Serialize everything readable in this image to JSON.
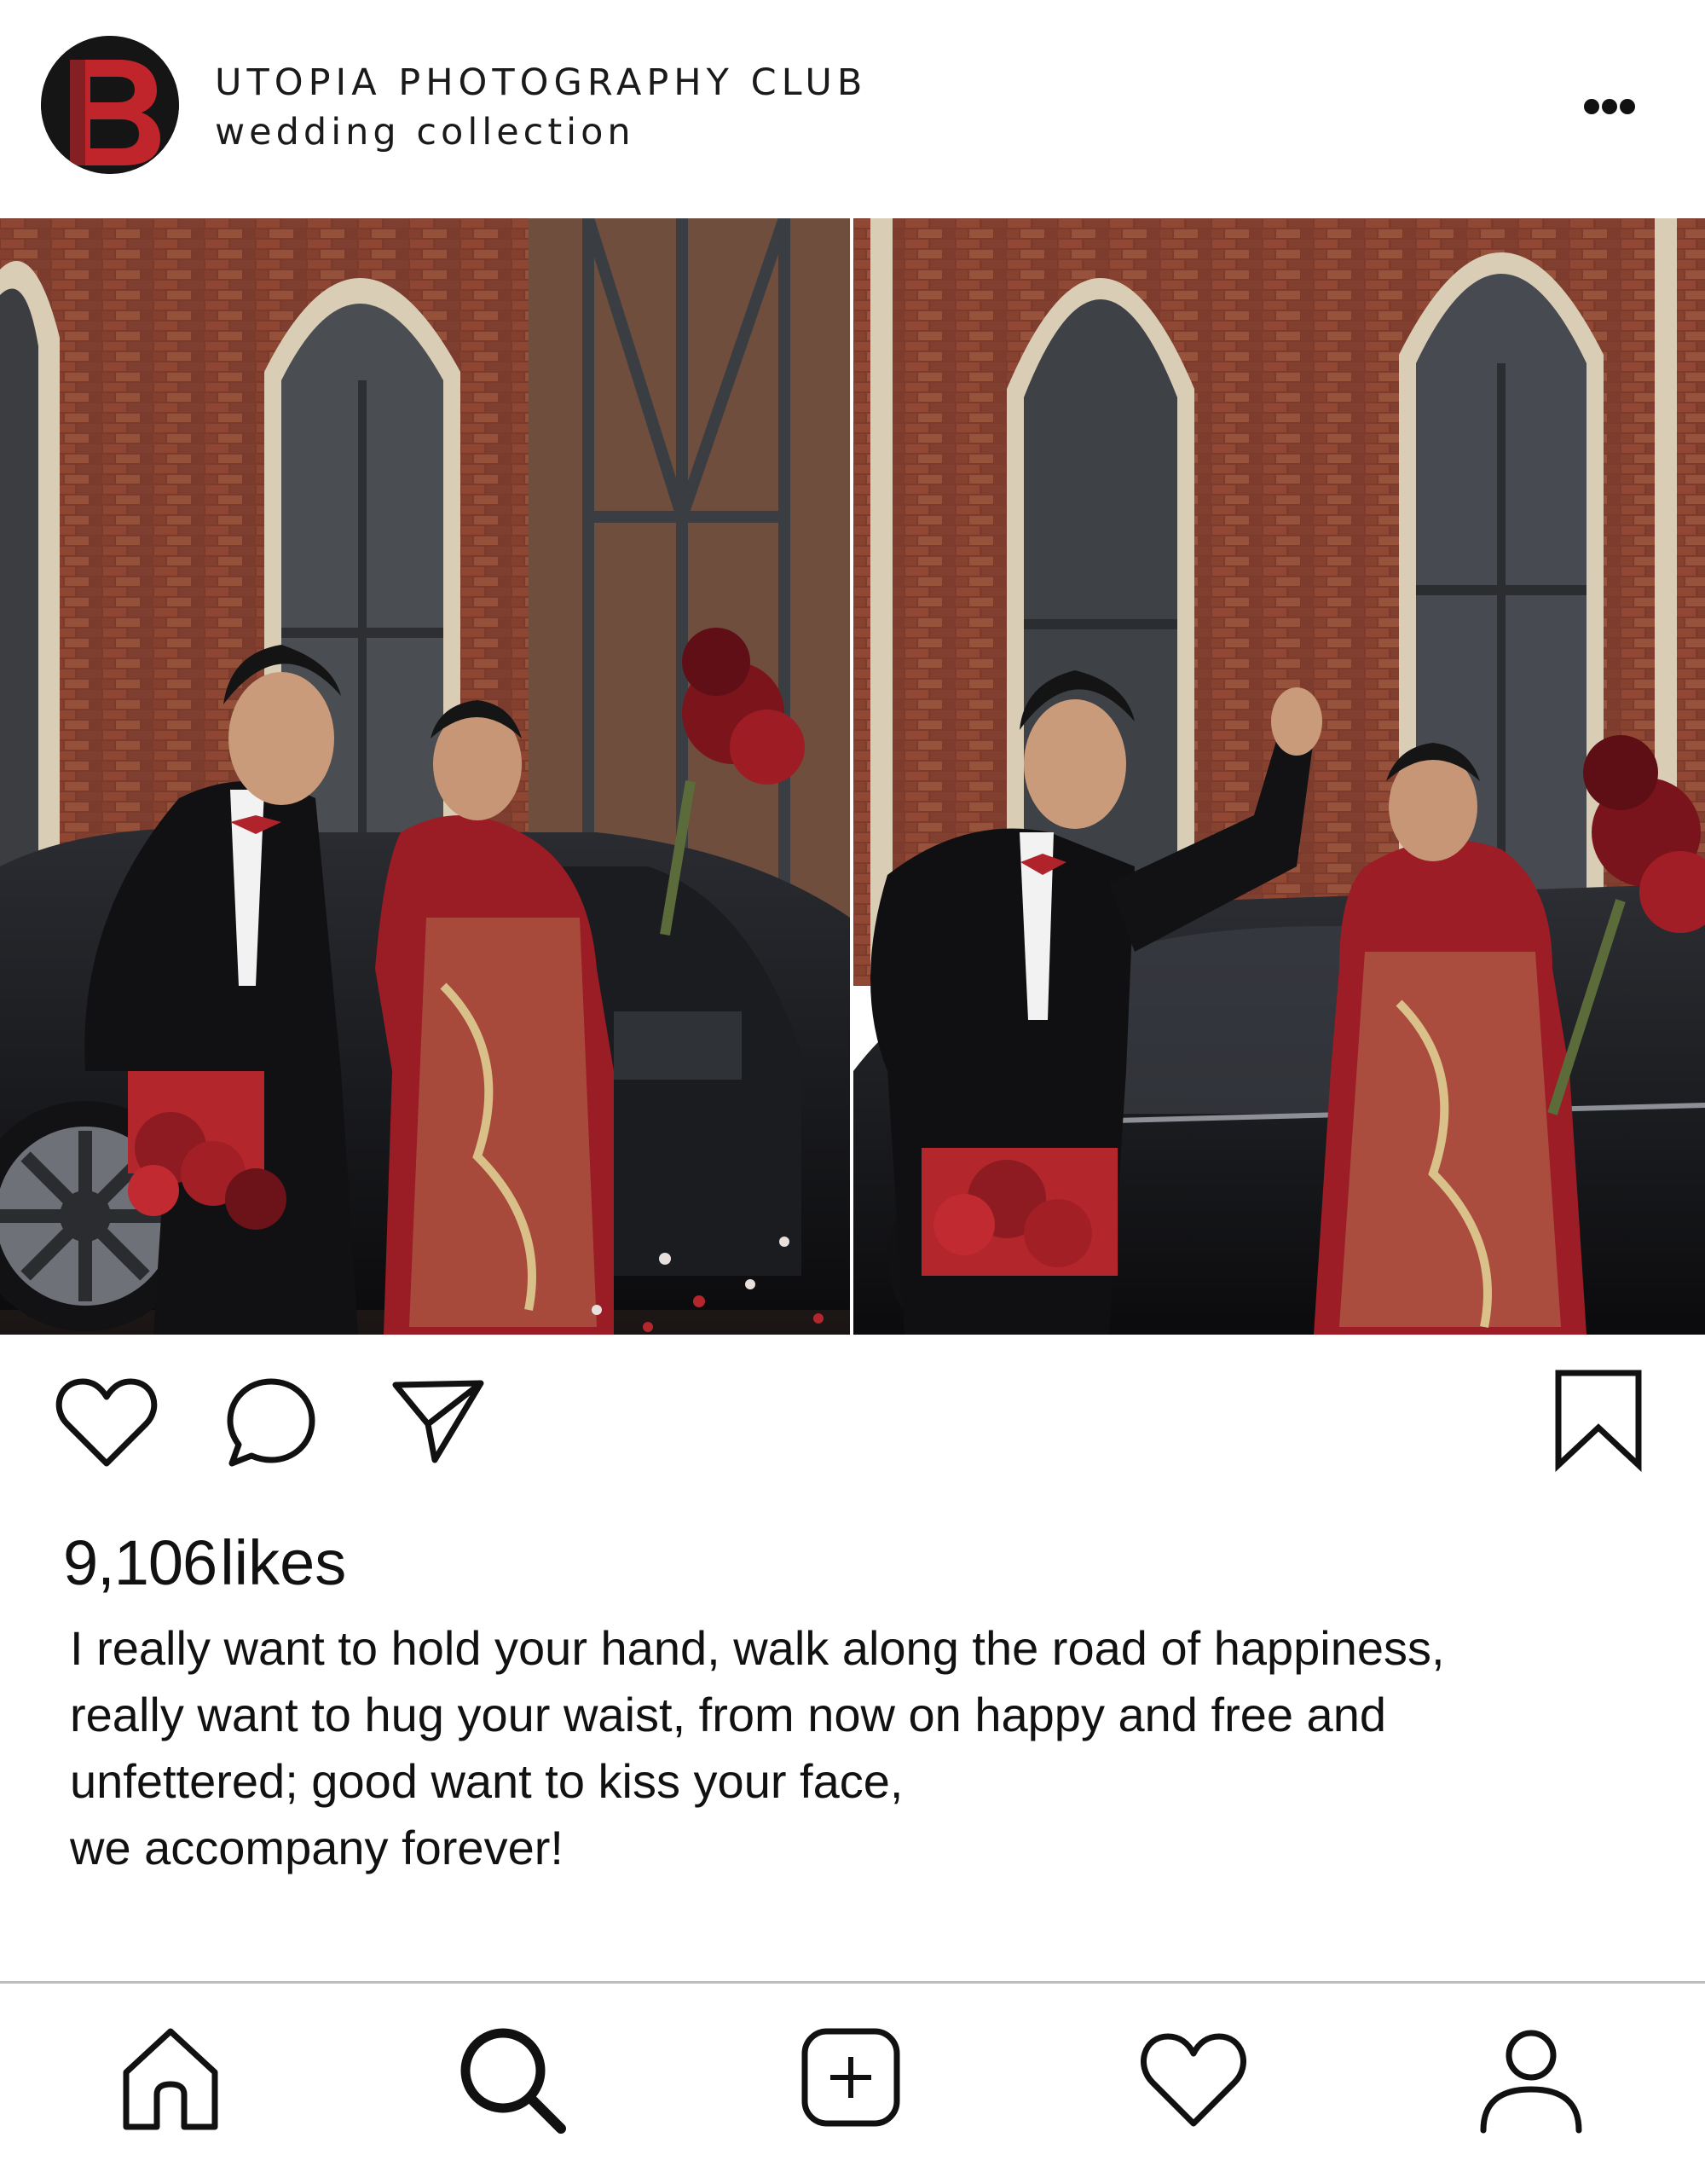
{
  "header": {
    "account_name": "UTOPIA PHOTOGRAPHY CLUB",
    "account_subtitle": "wedding collection",
    "avatar_letter": "B",
    "avatar_icon": "b-logo-avatar",
    "more_icon": "more-horizontal-icon"
  },
  "post": {
    "photos": [
      {
        "name": "wedding-photo-left",
        "scene": "groom in black tuxedo and bride in red embroidered dress beside black car, brick arched windows"
      },
      {
        "name": "wedding-photo-right",
        "scene": "groom waving beside car door, bride with red bouquet, brick arched windows"
      }
    ],
    "actions": {
      "like_icon": "heart-icon",
      "comment_icon": "comment-icon",
      "share_icon": "send-icon",
      "save_icon": "bookmark-icon"
    },
    "likes_count": "9,106",
    "likes_label": "likes",
    "caption_lines": [
      "I really want to hold your hand, walk along the road of happiness,",
      "really want to hug your waist, from now on happy and free and",
      "unfettered; good want to kiss your face,",
      "we accompany forever!"
    ]
  },
  "nav": {
    "items": [
      {
        "name": "home",
        "icon": "home-icon"
      },
      {
        "name": "search",
        "icon": "search-icon"
      },
      {
        "name": "create",
        "icon": "add-post-icon"
      },
      {
        "name": "activity",
        "icon": "heart-icon"
      },
      {
        "name": "profile",
        "icon": "profile-icon"
      }
    ]
  },
  "colors": {
    "background": "#ffffff",
    "text": "#111111",
    "brand_red": "#c0252b",
    "divider": "#bdbdbd"
  }
}
